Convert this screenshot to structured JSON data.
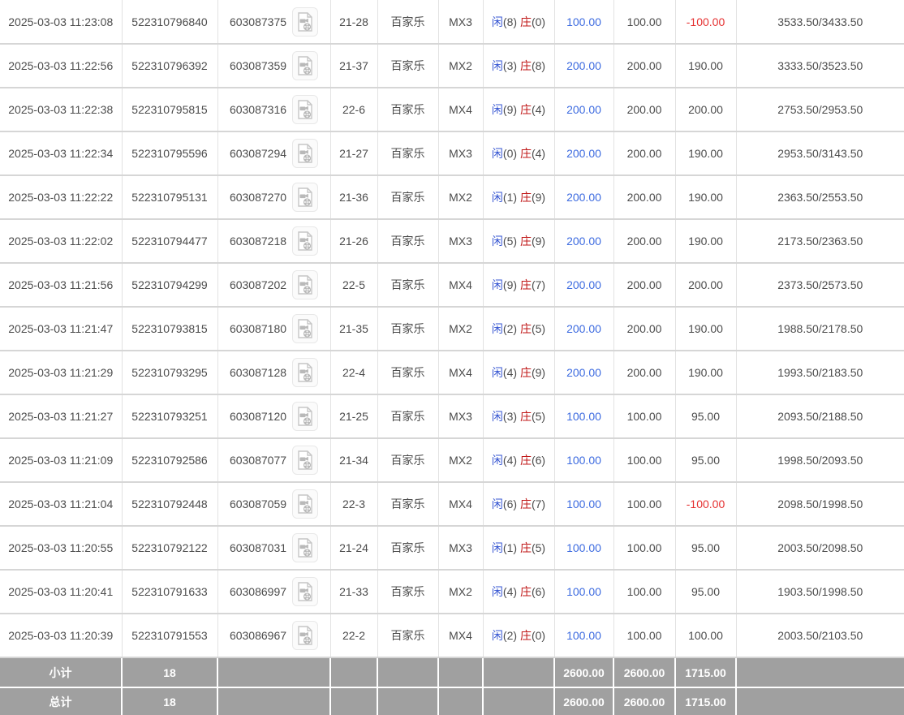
{
  "colors": {
    "text": "#4c4c4c",
    "player_blue": "#3656d2",
    "amount_blue": "#3d6be0",
    "banker_red": "#c01818",
    "negative_red": "#e53030",
    "row_border": "#d6d6d6",
    "footer_bg": "#a0a0a0",
    "footer_text": "#ffffff"
  },
  "labels": {
    "player_label": "闲",
    "banker_label": "庄",
    "game_name": "百家乐",
    "video_icon": "video-replay-icon"
  },
  "table": {
    "rows": [
      {
        "time": "2025-03-03 11:23:08",
        "bet_id": "522310796840",
        "game_id": "603087375",
        "round": "21-28",
        "game": "百家乐",
        "table_type": "MX3",
        "player_count": "(8)",
        "banker_count": "(0)",
        "bet_amount": "100.00",
        "valid_amount": "100.00",
        "win_loss": "-100.00",
        "balance": "3533.50/3433.50"
      },
      {
        "time": "2025-03-03 11:22:56",
        "bet_id": "522310796392",
        "game_id": "603087359",
        "round": "21-37",
        "game": "百家乐",
        "table_type": "MX2",
        "player_count": "(3)",
        "banker_count": "(8)",
        "bet_amount": "200.00",
        "valid_amount": "200.00",
        "win_loss": "190.00",
        "balance": "3333.50/3523.50"
      },
      {
        "time": "2025-03-03 11:22:38",
        "bet_id": "522310795815",
        "game_id": "603087316",
        "round": "22-6",
        "game": "百家乐",
        "table_type": "MX4",
        "player_count": "(9)",
        "banker_count": "(4)",
        "bet_amount": "200.00",
        "valid_amount": "200.00",
        "win_loss": "200.00",
        "balance": "2753.50/2953.50"
      },
      {
        "time": "2025-03-03 11:22:34",
        "bet_id": "522310795596",
        "game_id": "603087294",
        "round": "21-27",
        "game": "百家乐",
        "table_type": "MX3",
        "player_count": "(0)",
        "banker_count": "(4)",
        "bet_amount": "200.00",
        "valid_amount": "200.00",
        "win_loss": "190.00",
        "balance": "2953.50/3143.50"
      },
      {
        "time": "2025-03-03 11:22:22",
        "bet_id": "522310795131",
        "game_id": "603087270",
        "round": "21-36",
        "game": "百家乐",
        "table_type": "MX2",
        "player_count": "(1)",
        "banker_count": "(9)",
        "bet_amount": "200.00",
        "valid_amount": "200.00",
        "win_loss": "190.00",
        "balance": "2363.50/2553.50"
      },
      {
        "time": "2025-03-03 11:22:02",
        "bet_id": "522310794477",
        "game_id": "603087218",
        "round": "21-26",
        "game": "百家乐",
        "table_type": "MX3",
        "player_count": "(5)",
        "banker_count": "(9)",
        "bet_amount": "200.00",
        "valid_amount": "200.00",
        "win_loss": "190.00",
        "balance": "2173.50/2363.50"
      },
      {
        "time": "2025-03-03 11:21:56",
        "bet_id": "522310794299",
        "game_id": "603087202",
        "round": "22-5",
        "game": "百家乐",
        "table_type": "MX4",
        "player_count": "(9)",
        "banker_count": "(7)",
        "bet_amount": "200.00",
        "valid_amount": "200.00",
        "win_loss": "200.00",
        "balance": "2373.50/2573.50"
      },
      {
        "time": "2025-03-03 11:21:47",
        "bet_id": "522310793815",
        "game_id": "603087180",
        "round": "21-35",
        "game": "百家乐",
        "table_type": "MX2",
        "player_count": "(2)",
        "banker_count": "(5)",
        "bet_amount": "200.00",
        "valid_amount": "200.00",
        "win_loss": "190.00",
        "balance": "1988.50/2178.50"
      },
      {
        "time": "2025-03-03 11:21:29",
        "bet_id": "522310793295",
        "game_id": "603087128",
        "round": "22-4",
        "game": "百家乐",
        "table_type": "MX4",
        "player_count": "(4)",
        "banker_count": "(9)",
        "bet_amount": "200.00",
        "valid_amount": "200.00",
        "win_loss": "190.00",
        "balance": "1993.50/2183.50"
      },
      {
        "time": "2025-03-03 11:21:27",
        "bet_id": "522310793251",
        "game_id": "603087120",
        "round": "21-25",
        "game": "百家乐",
        "table_type": "MX3",
        "player_count": "(3)",
        "banker_count": "(5)",
        "bet_amount": "100.00",
        "valid_amount": "100.00",
        "win_loss": "95.00",
        "balance": "2093.50/2188.50"
      },
      {
        "time": "2025-03-03 11:21:09",
        "bet_id": "522310792586",
        "game_id": "603087077",
        "round": "21-34",
        "game": "百家乐",
        "table_type": "MX2",
        "player_count": "(4)",
        "banker_count": "(6)",
        "bet_amount": "100.00",
        "valid_amount": "100.00",
        "win_loss": "95.00",
        "balance": "1998.50/2093.50"
      },
      {
        "time": "2025-03-03 11:21:04",
        "bet_id": "522310792448",
        "game_id": "603087059",
        "round": "22-3",
        "game": "百家乐",
        "table_type": "MX4",
        "player_count": "(6)",
        "banker_count": "(7)",
        "bet_amount": "100.00",
        "valid_amount": "100.00",
        "win_loss": "-100.00",
        "balance": "2098.50/1998.50"
      },
      {
        "time": "2025-03-03 11:20:55",
        "bet_id": "522310792122",
        "game_id": "603087031",
        "round": "21-24",
        "game": "百家乐",
        "table_type": "MX3",
        "player_count": "(1)",
        "banker_count": "(5)",
        "bet_amount": "100.00",
        "valid_amount": "100.00",
        "win_loss": "95.00",
        "balance": "2003.50/2098.50"
      },
      {
        "time": "2025-03-03 11:20:41",
        "bet_id": "522310791633",
        "game_id": "603086997",
        "round": "21-33",
        "game": "百家乐",
        "table_type": "MX2",
        "player_count": "(4)",
        "banker_count": "(6)",
        "bet_amount": "100.00",
        "valid_amount": "100.00",
        "win_loss": "95.00",
        "balance": "1903.50/1998.50"
      },
      {
        "time": "2025-03-03 11:20:39",
        "bet_id": "522310791553",
        "game_id": "603086967",
        "round": "22-2",
        "game": "百家乐",
        "table_type": "MX4",
        "player_count": "(2)",
        "banker_count": "(0)",
        "bet_amount": "100.00",
        "valid_amount": "100.00",
        "win_loss": "100.00",
        "balance": "2003.50/2103.50"
      }
    ],
    "summary_rows": [
      {
        "label": "小计",
        "count": "18",
        "bet_amount": "2600.00",
        "valid_amount": "2600.00",
        "win_loss": "1715.00"
      },
      {
        "label": "总计",
        "count": "18",
        "bet_amount": "2600.00",
        "valid_amount": "2600.00",
        "win_loss": "1715.00"
      }
    ]
  }
}
